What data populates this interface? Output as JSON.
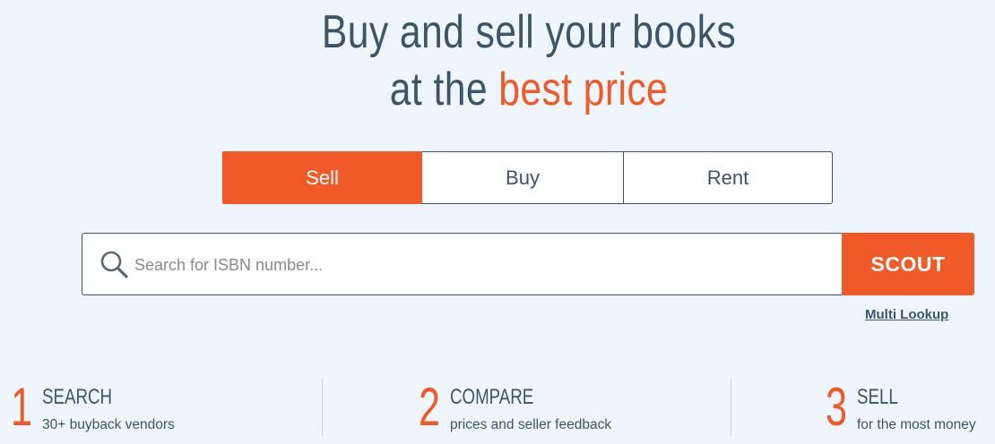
{
  "hero": {
    "line1": "Buy and sell your books",
    "line2_prefix": "at the ",
    "line2_accent": "best price"
  },
  "tabs": [
    {
      "label": "Sell",
      "active": true
    },
    {
      "label": "Buy",
      "active": false
    },
    {
      "label": "Rent",
      "active": false
    }
  ],
  "search": {
    "placeholder": "Search for ISBN number...",
    "value": "",
    "button_label": "SCOUT",
    "multi_lookup": "Multi Lookup"
  },
  "steps": [
    {
      "number": "1",
      "title": "SEARCH",
      "desc": "30+ buyback vendors"
    },
    {
      "number": "2",
      "title": "COMPARE",
      "desc": "prices and seller feedback"
    },
    {
      "number": "3",
      "title": "SELL",
      "desc": "for the most money"
    }
  ],
  "colors": {
    "accent": "#f05a28",
    "text": "#3d5566",
    "background": "#eef6fb"
  },
  "icons": {
    "search": "search-icon"
  }
}
